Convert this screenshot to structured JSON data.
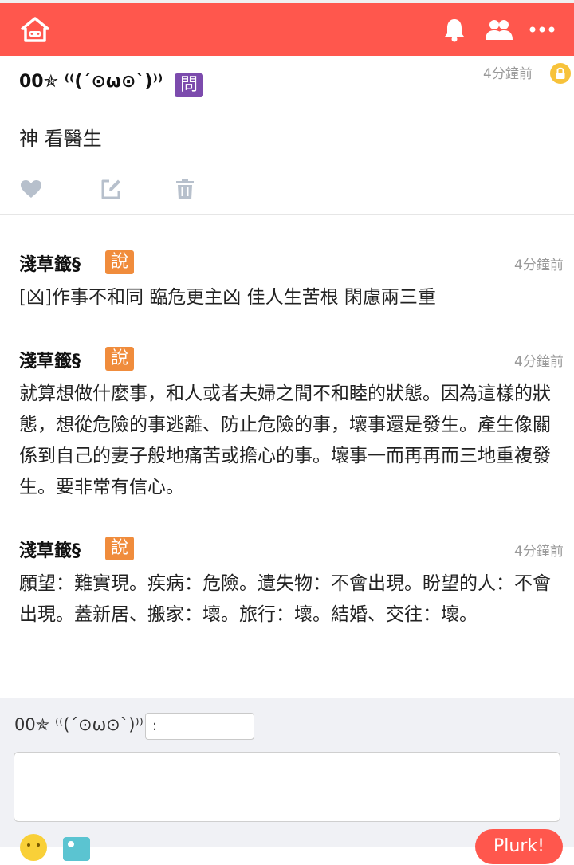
{
  "topbar": {
    "icons": [
      "home-icon",
      "bell-icon",
      "friends-icon",
      "more-icon"
    ],
    "color": "#ff574d"
  },
  "post": {
    "author": "00✯ ⁽⁽(´⊙ω⊙`)⁾⁾",
    "qualifier": "問",
    "qualifier_color": "#7c4bad",
    "time": "4分鐘前",
    "content": "神 看醫生"
  },
  "responses": [
    {
      "author": "淺草籤§",
      "qualifier": "說",
      "time": "4分鐘前",
      "text": "[凶]作事不和同 臨危更主凶 佳人生苦根 閑慮兩三重"
    },
    {
      "author": "淺草籤§",
      "qualifier": "說",
      "time": "4分鐘前",
      "text": "就算想做什麼事，和人或者夫婦之間不和睦的狀態。因為這樣的狀態，想從危險的事逃離、防止危險的事，壞事還是發生。產生像關係到自己的妻子般地痛苦或擔心的事。壞事一而再再而三地重複發生。要非常有信心。"
    },
    {
      "author": "淺草籤§",
      "qualifier": "說",
      "time": "4分鐘前",
      "text": "願望：難實現。疾病：危險。遺失物：不會出現。盼望的人：不會出現。蓋新居、搬家：壞。旅行：壞。結婚、交往：壞。"
    }
  ],
  "composer": {
    "name": "00✯ ⁽⁽(´⊙ω⊙`)⁾⁾",
    "qualifier_value": ":",
    "button_label": "Plurk!"
  }
}
